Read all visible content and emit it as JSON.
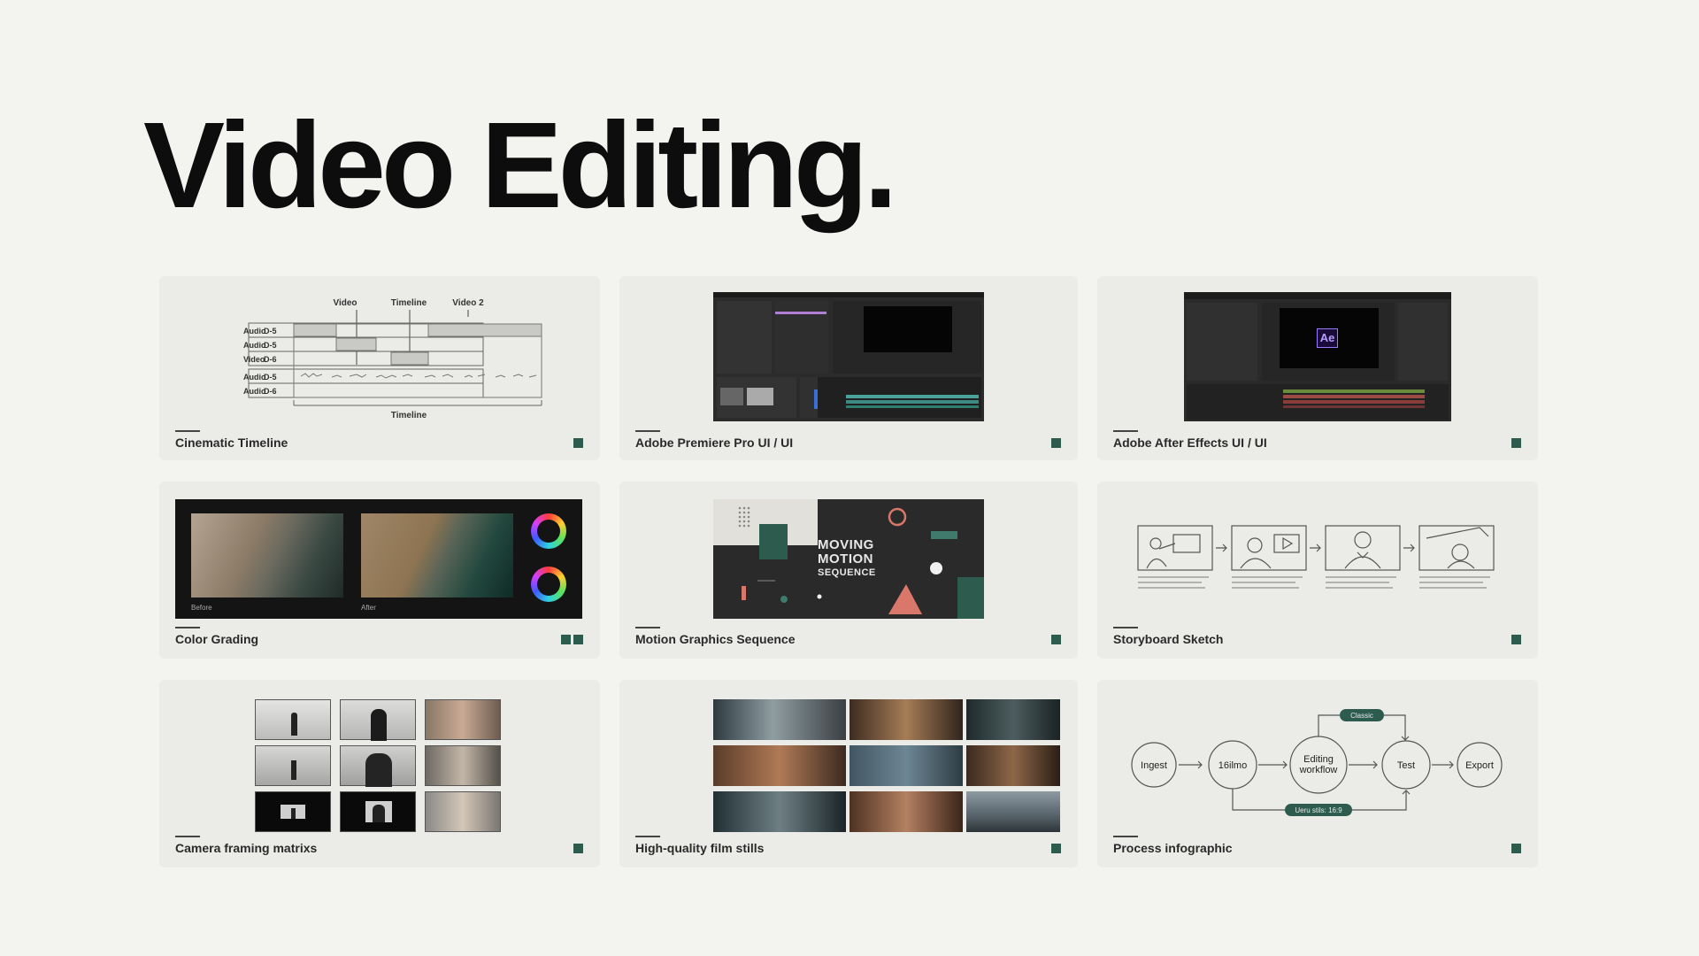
{
  "page": {
    "title": "Video Editing."
  },
  "accent_color": "#2d5c4f",
  "cards": [
    {
      "label": "Cinematic Timeline"
    },
    {
      "label": "Adobe Premiere Pro UI / UI"
    },
    {
      "label": "Adobe After Effects UI / UI"
    },
    {
      "label": "Color Grading"
    },
    {
      "label": "Motion Graphics Sequence"
    },
    {
      "label": "Storyboard Sketch"
    },
    {
      "label": "Camera framing matrixs"
    },
    {
      "label": "High-quality film stills"
    },
    {
      "label": "Process infographic"
    }
  ],
  "timeline": {
    "top_labels": [
      "Video",
      "Timeline",
      "Video 2"
    ],
    "rows": [
      {
        "type": "Audio",
        "code": "D-5"
      },
      {
        "type": "Audio",
        "code": "D-5"
      },
      {
        "type": "Video",
        "code": "D-6"
      },
      {
        "type": "Audio",
        "code": "D-5"
      },
      {
        "type": "Audio",
        "code": "D-6"
      }
    ],
    "bottom_label": "Timeline"
  },
  "after_effects": {
    "logo": "Ae"
  },
  "color_grading": {
    "before": "Before",
    "after": "After"
  },
  "motion": {
    "lines": [
      "MOVING",
      "MOTION",
      "SEQUENCE"
    ]
  },
  "process": {
    "nodes": [
      "Ingest",
      "16ilmo",
      "Editing workflow",
      "Test",
      "Export"
    ],
    "top_badge": "Classic",
    "bottom_badge": "Ueru stils: 16:9"
  }
}
